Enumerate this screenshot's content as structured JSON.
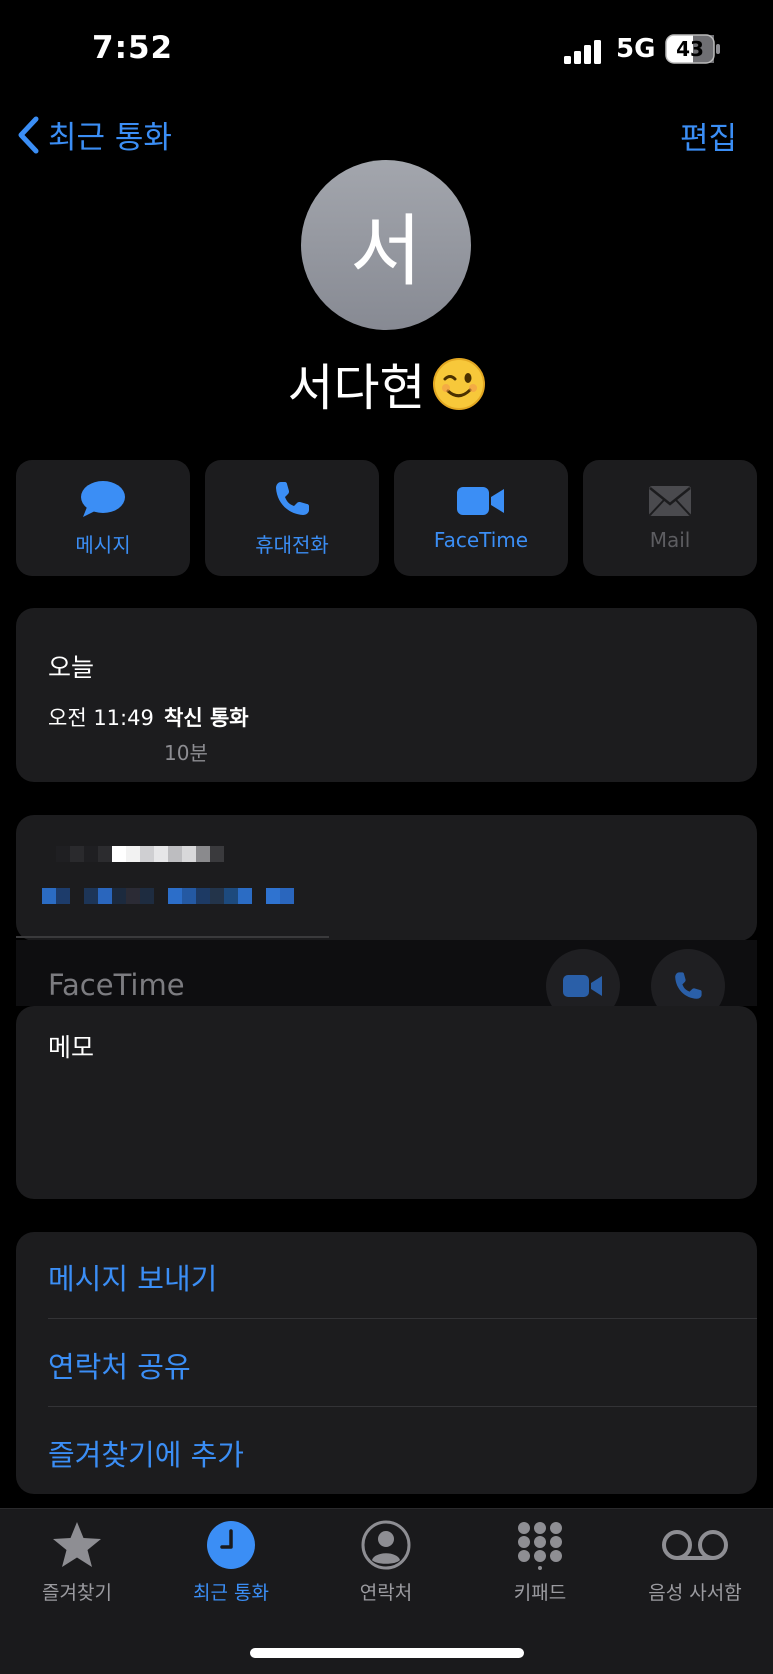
{
  "status_bar": {
    "time": "7:52",
    "network": "5G",
    "battery": "43"
  },
  "nav": {
    "back_label": "최근 통화",
    "edit_label": "편집"
  },
  "contact": {
    "avatar_initial": "서",
    "name": "서다현",
    "emoji_icon": "winking-face-icon"
  },
  "actions": [
    {
      "label": "메시지",
      "icon": "message-bubble-icon"
    },
    {
      "label": "휴대전화",
      "icon": "phone-icon"
    },
    {
      "label": "FaceTime",
      "icon": "video-camera-icon"
    },
    {
      "label": "Mail",
      "icon": "mail-icon"
    }
  ],
  "recent_calls": {
    "section_label": "오늘",
    "time": "오전 11:49",
    "type": "착신 통화",
    "duration": "10분"
  },
  "number_card": {
    "facetime_label": "FaceTime"
  },
  "memo": {
    "label": "메모"
  },
  "links": [
    "메시지 보내기",
    "연락처 공유",
    "즐겨찾기에 추가"
  ],
  "tabs": [
    {
      "label": "즐겨찾기",
      "icon": "star-icon"
    },
    {
      "label": "최근 통화",
      "icon": "clock-icon",
      "active": true
    },
    {
      "label": "연락처",
      "icon": "person-circle-icon"
    },
    {
      "label": "키패드",
      "icon": "keypad-icon"
    },
    {
      "label": "음성 사서함",
      "icon": "voicemail-icon"
    }
  ],
  "colors": {
    "accent": "#3b8ef5",
    "card": "#1c1c1e",
    "background": "#000000"
  }
}
